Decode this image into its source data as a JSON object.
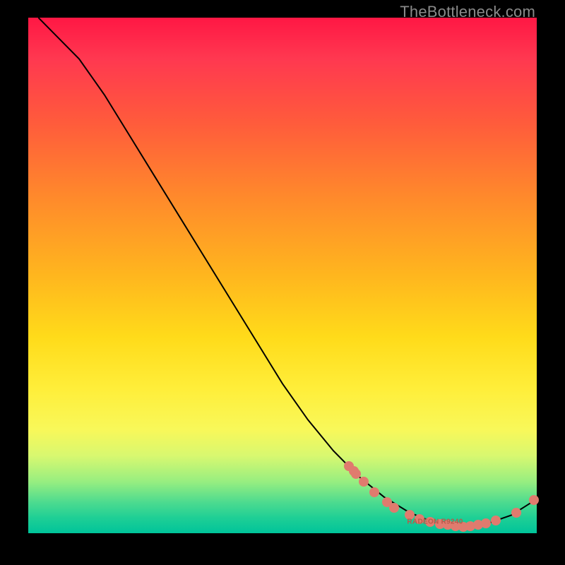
{
  "watermark": "TheBottleneck.com",
  "annotation_label": "RADEON R9240",
  "chart_data": {
    "type": "line",
    "title": "",
    "xlabel": "",
    "ylabel": "",
    "xlim": [
      0,
      100
    ],
    "ylim": [
      0,
      100
    ],
    "curve_points": [
      {
        "x": 2,
        "y": 100
      },
      {
        "x": 5,
        "y": 97
      },
      {
        "x": 10,
        "y": 92
      },
      {
        "x": 15,
        "y": 85
      },
      {
        "x": 20,
        "y": 77
      },
      {
        "x": 25,
        "y": 69
      },
      {
        "x": 30,
        "y": 61
      },
      {
        "x": 35,
        "y": 53
      },
      {
        "x": 40,
        "y": 45
      },
      {
        "x": 45,
        "y": 37
      },
      {
        "x": 50,
        "y": 29
      },
      {
        "x": 55,
        "y": 22
      },
      {
        "x": 60,
        "y": 16
      },
      {
        "x": 65,
        "y": 11
      },
      {
        "x": 70,
        "y": 7
      },
      {
        "x": 75,
        "y": 4
      },
      {
        "x": 80,
        "y": 2
      },
      {
        "x": 85,
        "y": 1.3
      },
      {
        "x": 90,
        "y": 1.8
      },
      {
        "x": 95,
        "y": 3.5
      },
      {
        "x": 99,
        "y": 6
      }
    ],
    "scatter_points": [
      {
        "x": 63,
        "y": 13
      },
      {
        "x": 64,
        "y": 12
      },
      {
        "x": 64.5,
        "y": 11.5
      },
      {
        "x": 66,
        "y": 10
      },
      {
        "x": 68,
        "y": 8
      },
      {
        "x": 70.5,
        "y": 6
      },
      {
        "x": 72,
        "y": 5
      },
      {
        "x": 75,
        "y": 3.5
      },
      {
        "x": 77,
        "y": 2.8
      },
      {
        "x": 79,
        "y": 2.2
      },
      {
        "x": 81,
        "y": 1.8
      },
      {
        "x": 82.5,
        "y": 1.6
      },
      {
        "x": 84,
        "y": 1.4
      },
      {
        "x": 85.5,
        "y": 1.3
      },
      {
        "x": 87,
        "y": 1.4
      },
      {
        "x": 88.5,
        "y": 1.6
      },
      {
        "x": 90,
        "y": 1.9
      },
      {
        "x": 92,
        "y": 2.5
      },
      {
        "x": 96,
        "y": 4
      },
      {
        "x": 99.5,
        "y": 6.5
      }
    ],
    "annotation": {
      "x": 80,
      "y": 2.2
    }
  }
}
